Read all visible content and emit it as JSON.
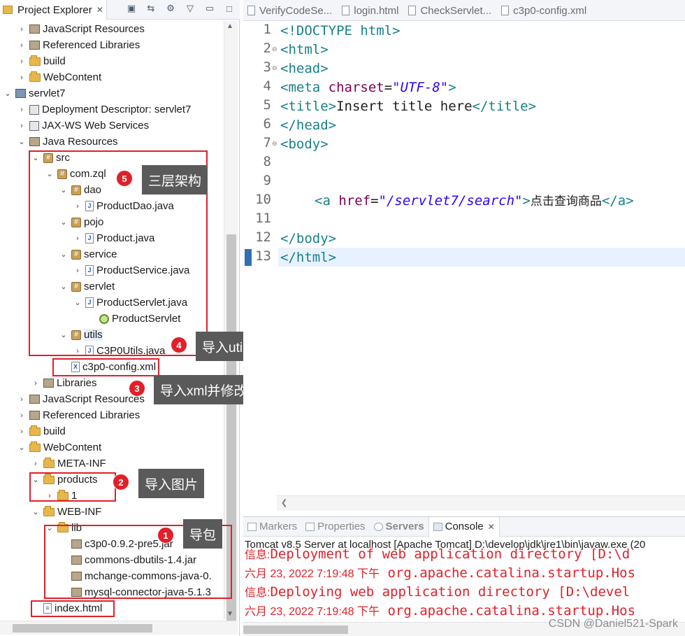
{
  "project_explorer": {
    "title": "Project Explorer",
    "tree": [
      {
        "label": "JavaScript Resources",
        "icon": "js-resources-icon",
        "chev": "›"
      },
      {
        "label": "Referenced Libraries",
        "icon": "library-icon",
        "chev": "›"
      },
      {
        "label": "build",
        "icon": "folder-icon",
        "chev": "›"
      },
      {
        "label": "WebContent",
        "icon": "folder-icon",
        "chev": "›"
      },
      {
        "label": "servlet7",
        "icon": "project-icon",
        "chev": "⌄"
      },
      {
        "label": "Deployment Descriptor: servlet7",
        "icon": "deployment-descriptor-icon",
        "chev": "›"
      },
      {
        "label": "JAX-WS Web Services",
        "icon": "web-services-icon",
        "chev": "›"
      },
      {
        "label": "Java Resources",
        "icon": "java-resources-icon",
        "chev": "⌄"
      },
      {
        "label": "src",
        "icon": "source-folder-icon",
        "chev": "⌄"
      },
      {
        "label": "com.zql",
        "icon": "package-icon",
        "chev": "⌄"
      },
      {
        "label": "dao",
        "icon": "package-icon",
        "chev": "⌄"
      },
      {
        "label": "ProductDao.java",
        "icon": "java-file-icon",
        "chev": "›"
      },
      {
        "label": "pojo",
        "icon": "package-icon",
        "chev": "⌄"
      },
      {
        "label": "Product.java",
        "icon": "java-file-icon",
        "chev": "›"
      },
      {
        "label": "service",
        "icon": "package-icon",
        "chev": "⌄"
      },
      {
        "label": "ProductService.java",
        "icon": "java-file-icon",
        "chev": "›"
      },
      {
        "label": "servlet",
        "icon": "package-icon",
        "chev": "⌄"
      },
      {
        "label": "ProductServlet.java",
        "icon": "java-file-icon",
        "chev": "⌄"
      },
      {
        "label": "ProductServlet",
        "icon": "servlet-class-icon",
        "chev": ""
      },
      {
        "label": "utils",
        "icon": "package-icon",
        "chev": "⌄"
      },
      {
        "label": "C3P0Utils.java",
        "icon": "java-file-icon",
        "chev": "›"
      },
      {
        "label": "c3p0-config.xml",
        "icon": "xml-file-icon",
        "chev": ""
      },
      {
        "label": "Libraries",
        "icon": "library-icon",
        "chev": "›"
      },
      {
        "label": "JavaScript Resources",
        "icon": "js-resources-icon",
        "chev": "›"
      },
      {
        "label": "Referenced Libraries",
        "icon": "library-icon",
        "chev": "›"
      },
      {
        "label": "build",
        "icon": "folder-icon",
        "chev": "›"
      },
      {
        "label": "WebContent",
        "icon": "folder-icon",
        "chev": "⌄"
      },
      {
        "label": "META-INF",
        "icon": "folder-icon",
        "chev": "›"
      },
      {
        "label": "products",
        "icon": "folder-icon",
        "chev": "⌄"
      },
      {
        "label": "1",
        "icon": "folder-icon",
        "chev": "›"
      },
      {
        "label": "WEB-INF",
        "icon": "folder-icon",
        "chev": "⌄"
      },
      {
        "label": "lib",
        "icon": "folder-icon",
        "chev": "⌄"
      },
      {
        "label": "c3p0-0.9.2-pre5.jar",
        "icon": "jar-icon",
        "chev": ""
      },
      {
        "label": "commons-dbutils-1.4.jar",
        "icon": "jar-icon",
        "chev": ""
      },
      {
        "label": "mchange-commons-java-0.",
        "icon": "jar-icon",
        "chev": ""
      },
      {
        "label": "mysql-connector-java-5.1.3",
        "icon": "jar-icon",
        "chev": ""
      },
      {
        "label": "index.html",
        "icon": "html-file-icon",
        "chev": ""
      }
    ]
  },
  "annotations": [
    {
      "num": "5",
      "text": "三层架构"
    },
    {
      "num": "4",
      "text": "导入utils"
    },
    {
      "num": "3",
      "text": "导入xml并修改对应数据库"
    },
    {
      "num": "2",
      "text": "导入图片"
    },
    {
      "num": "1",
      "text": "导包"
    }
  ],
  "editor": {
    "tabs": [
      "VerifyCodeSe...",
      "login.html",
      "CheckServlet...",
      "c3p0-config.xml"
    ],
    "line_numbers": [
      "1",
      "2",
      "3",
      "4",
      "5",
      "6",
      "7",
      "8",
      "9",
      "10",
      "11",
      "12",
      "13"
    ],
    "code": {
      "l1_tag": "<!DOCTYPE html>",
      "l2": "<html>",
      "l3": "<head>",
      "l4_tag": "<meta ",
      "l4_attr": "charset",
      "l4_eq": "=",
      "l4_val": "\"UTF-8\"",
      "l4_end": ">",
      "l5_open": "<title>",
      "l5_text": "Insert title here",
      "l5_close": "</title>",
      "l6": "</head>",
      "l7": "<body>",
      "l10_open": "<a ",
      "l10_attr": "href",
      "l10_eq": "=",
      "l10_val": "\"/servlet7/search\"",
      "l10_gt": ">",
      "l10_text": "点击查询商品",
      "l10_close": "</a>",
      "l12": "</body>",
      "l13": "</html>"
    }
  },
  "console": {
    "tabs": [
      "Markers",
      "Properties",
      "Servers",
      "Console"
    ],
    "description": "Tomcat v8.5 Server at localhost [Apache Tomcat] D:\\develop\\jdk\\jre1\\bin\\javaw.exe (20",
    "lines": [
      {
        "ts": "信息:",
        "msg": "Deployment of web application directory [D:\\d"
      },
      {
        "ts": "六月 23, 2022 7:19:48 下午",
        "msg": " org.apache.catalina.startup.Hos"
      },
      {
        "ts": "信息:",
        "msg": "Deploying web application directory [D:\\devel"
      },
      {
        "ts": "六月 23, 2022 7:19:48 下午",
        "msg": " org.apache.catalina.startup.Hos"
      }
    ],
    "watermark": "CSDN @Daniel521-Spark"
  },
  "colors": {
    "annotation_red": "#e0202a",
    "tag_teal": "#17808a",
    "attr_purple": "#7f0055",
    "string_blue": "#2a00ff"
  }
}
